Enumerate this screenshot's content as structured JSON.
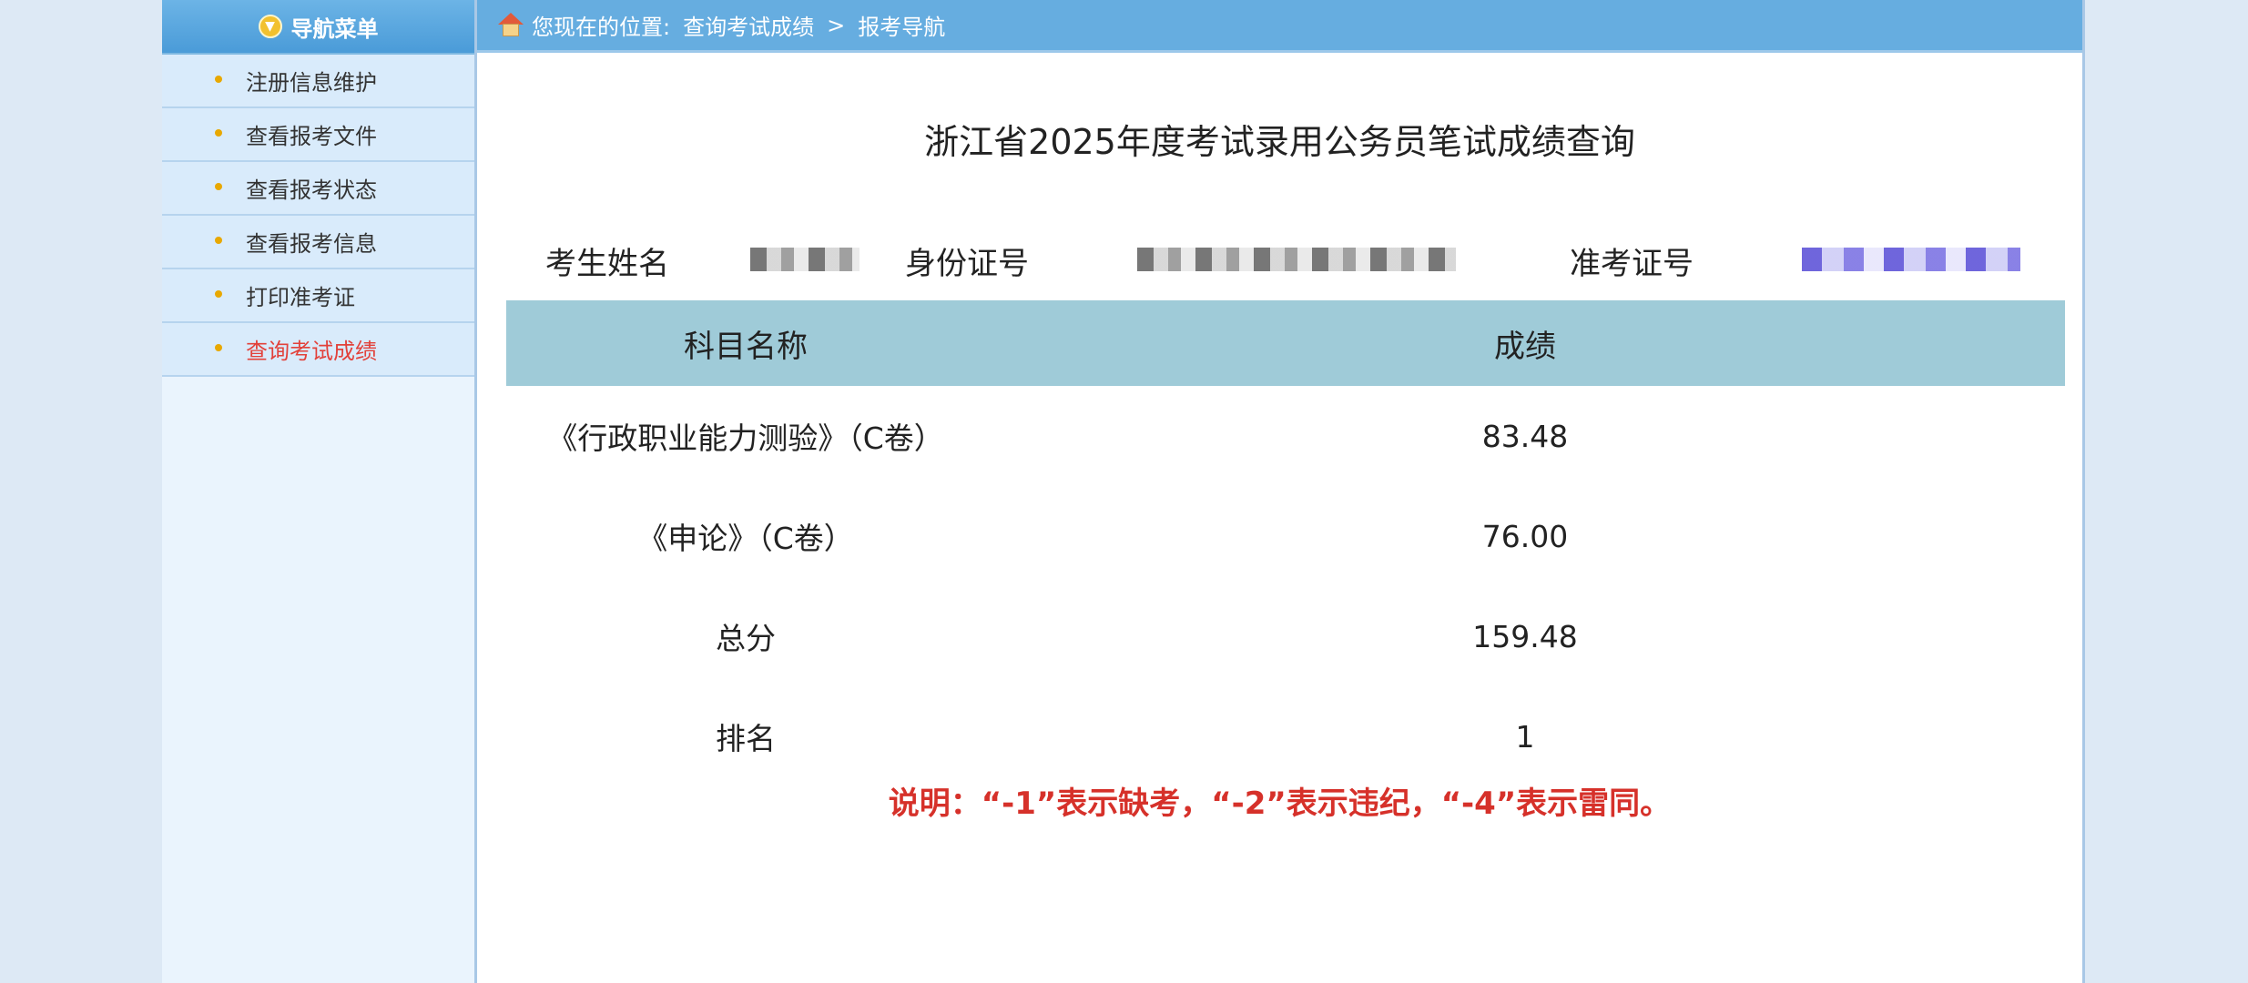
{
  "sidebar": {
    "header_label": "导航菜单",
    "items": [
      {
        "label": "注册信息维护",
        "active": false
      },
      {
        "label": "查看报考文件",
        "active": false
      },
      {
        "label": "查看报考状态",
        "active": false
      },
      {
        "label": "查看报考信息",
        "active": false
      },
      {
        "label": "打印准考证",
        "active": false
      },
      {
        "label": "查询考试成绩",
        "active": true
      }
    ],
    "active_color": "#e2413a"
  },
  "breadcrumb": {
    "prefix": "您现在的位置:",
    "current": "查询考试成绩",
    "separator": ">",
    "page": "报考导航"
  },
  "page": {
    "title": "浙江省2025年度考试录用公务员笔试成绩查询"
  },
  "candidate": {
    "name_label": "考生姓名",
    "id_label": "身份证号",
    "ticket_label": "准考证号"
  },
  "score_table": {
    "headers": [
      "科目名称",
      "成绩"
    ],
    "rows": [
      {
        "subject": "《行政职业能力测验》（C卷）",
        "score": "83.48"
      },
      {
        "subject": "《申论》（C卷）",
        "score": "76.00"
      },
      {
        "subject": "总分",
        "score": "159.48"
      },
      {
        "subject": "排名",
        "score": "1"
      }
    ]
  },
  "note": "说明：“-1”表示缺考，“-2”表示违纪，“-4”表示雷同。"
}
